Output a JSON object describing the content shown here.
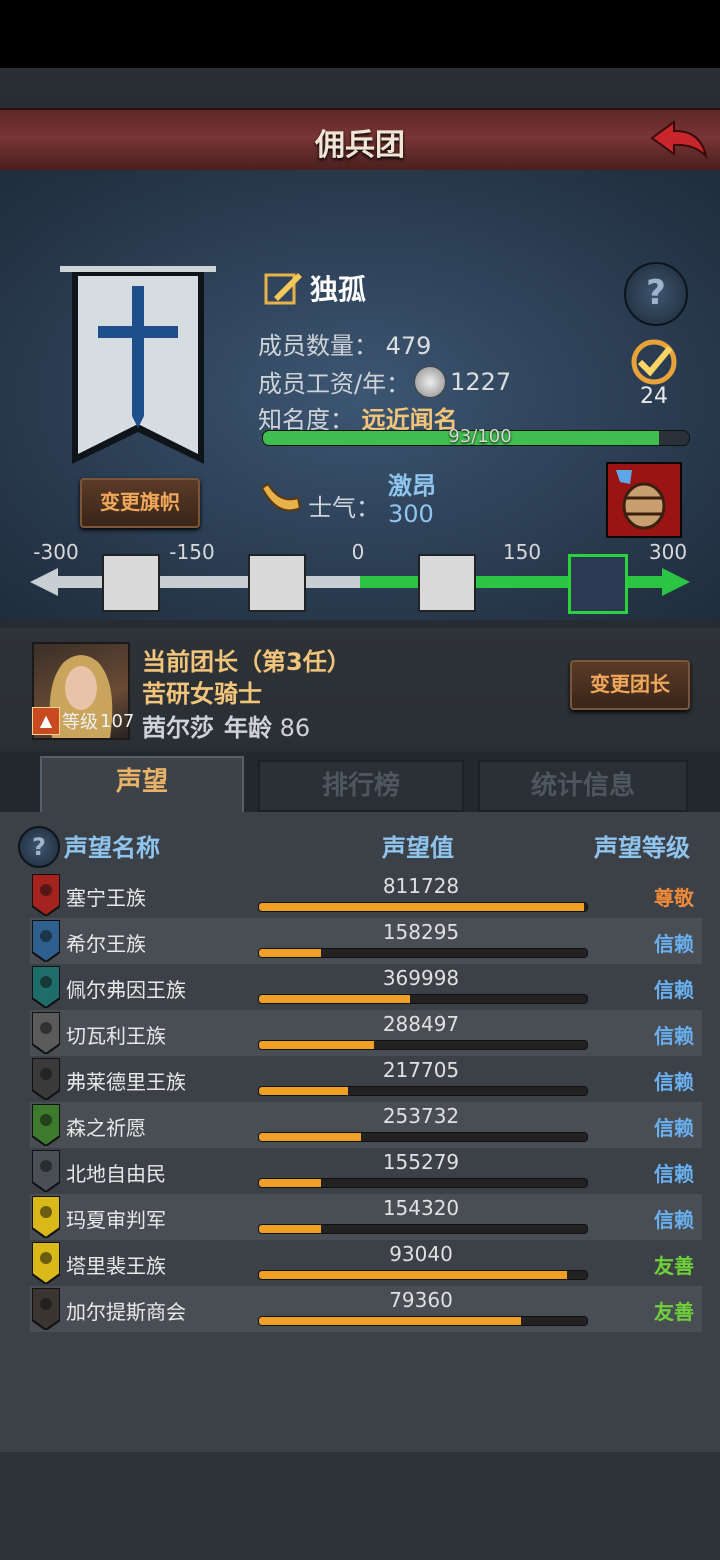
{
  "header": {
    "title": "佣兵团"
  },
  "company": {
    "name": "独孤",
    "members_label": "成员数量：",
    "members_value": "479",
    "wage_label": "成员工资/年：",
    "wage_value": "1227",
    "fame_label": "知名度：",
    "fame_value": "远近闻名",
    "fame_progress_text": "93/100",
    "fame_fraction": 0.93,
    "change_banner_label": "变更旗帜",
    "quest_count": "24"
  },
  "morale": {
    "label": "士气：",
    "state": "激昂",
    "value": "300",
    "scale_ticks": [
      "-300",
      "-150",
      "0",
      "150",
      "300"
    ]
  },
  "leader": {
    "title": "当前团长（第3任）",
    "class": "苦研女骑士",
    "level_label": "等级",
    "level_value": "107",
    "name": "茜尔莎",
    "age_label": "年龄",
    "age_value": "86",
    "change_leader_label": "变更团长"
  },
  "tabs": [
    {
      "label": "声望",
      "active": true
    },
    {
      "label": "排行榜",
      "active": false
    },
    {
      "label": "统计信息",
      "active": false
    }
  ],
  "table": {
    "col_name": "声望名称",
    "col_value": "声望值",
    "col_level": "声望等级",
    "rows": [
      {
        "name": "塞宁王族",
        "value": "811728",
        "fill": 0.99,
        "level": "尊敬",
        "level_color": "#f08a3a",
        "crest_color": "#a4231f"
      },
      {
        "name": "希尔王族",
        "value": "158295",
        "fill": 0.19,
        "level": "信赖",
        "level_color": "#6ab0f0",
        "crest_color": "#2f5f8e"
      },
      {
        "name": "佩尔弗因王族",
        "value": "369998",
        "fill": 0.46,
        "level": "信赖",
        "level_color": "#6ab0f0",
        "crest_color": "#1f6d6a"
      },
      {
        "name": "切瓦利王族",
        "value": "288497",
        "fill": 0.35,
        "level": "信赖",
        "level_color": "#6ab0f0",
        "crest_color": "#5b5b5b"
      },
      {
        "name": "弗莱德里王族",
        "value": "217705",
        "fill": 0.27,
        "level": "信赖",
        "level_color": "#6ab0f0",
        "crest_color": "#3a3a3a"
      },
      {
        "name": "森之祈愿",
        "value": "253732",
        "fill": 0.31,
        "level": "信赖",
        "level_color": "#6ab0f0",
        "crest_color": "#3e7a2e"
      },
      {
        "name": "北地自由民",
        "value": "155279",
        "fill": 0.19,
        "level": "信赖",
        "level_color": "#6ab0f0",
        "crest_color": "#4a4f55"
      },
      {
        "name": "玛夏审判军",
        "value": "154320",
        "fill": 0.19,
        "level": "信赖",
        "level_color": "#6ab0f0",
        "crest_color": "#d9b81a"
      },
      {
        "name": "塔里裴王族",
        "value": "93040",
        "fill": 0.94,
        "level": "友善",
        "level_color": "#6fd13a",
        "crest_color": "#d9b81a"
      },
      {
        "name": "加尔提斯商会",
        "value": "79360",
        "fill": 0.8,
        "level": "友善",
        "level_color": "#6fd13a",
        "crest_color": "#3a3530"
      }
    ]
  }
}
